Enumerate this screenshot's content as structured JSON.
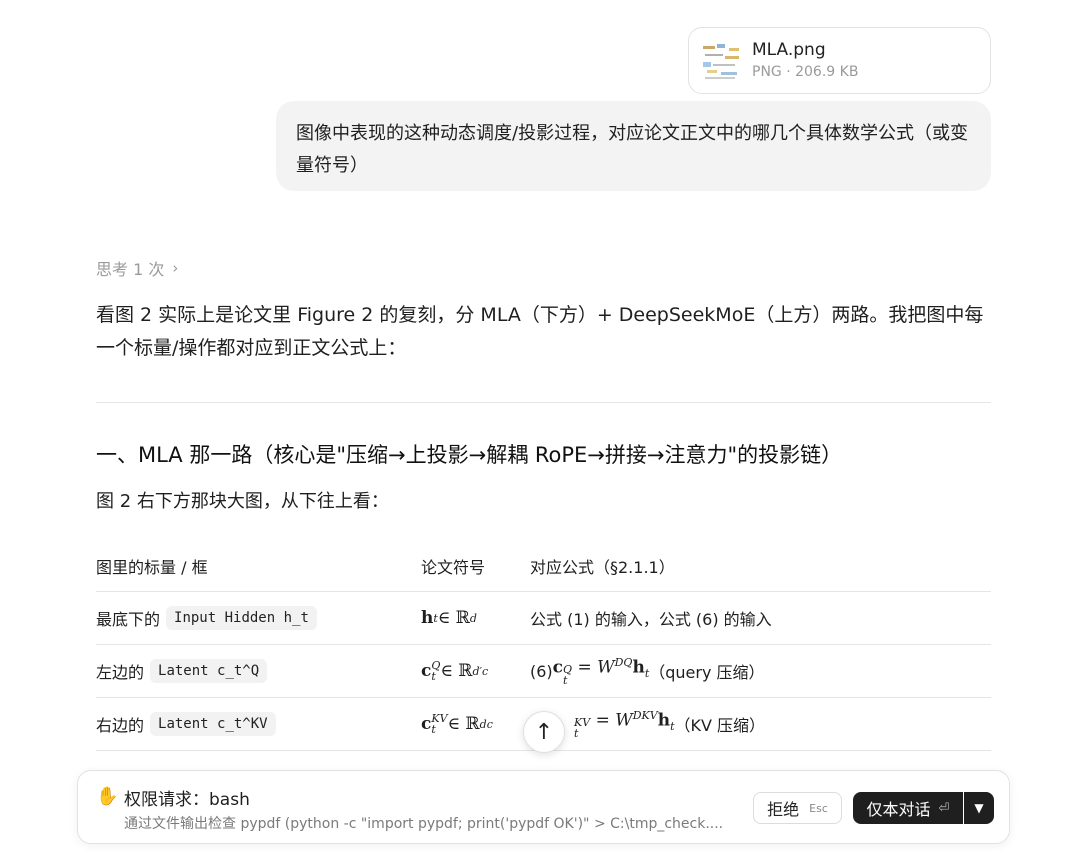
{
  "attachment": {
    "file_name": "MLA.png",
    "file_meta": "PNG · 206.9 KB"
  },
  "user_message": "图像中表现的这种动态调度/投影过程，对应论文正文中的哪几个具体数学公式（或变量符号）",
  "thinking_label": "思考 1 次",
  "intro": "看图 2 实际上是论文里 Figure 2 的复刻，分 MLA（下方）+ DeepSeekMoE（上方）两路。我把图中每一个标量/操作都对应到正文公式上：",
  "section_title": "一、MLA 那一路（核心是\"压缩→上投影→解耦 RoPE→拼接→注意力\"的投影链）",
  "section_sub": "图 2 右下方那块大图，从下往上看：",
  "table": {
    "headers": [
      "图里的标量 / 框",
      "论文符号",
      "对应公式（§2.1.1）"
    ],
    "rows": [
      {
        "prefix": "最底下的",
        "code": "Input Hidden h_t",
        "symbol": "h",
        "symbol_sub": "t",
        "symbol_rel": " ∈ ℝ",
        "symbol_sup": "d",
        "formula": "公式 (1) 的输入，公式 (6) 的输入"
      },
      {
        "prefix": "左边的",
        "code": "Latent c_t^Q",
        "symbol": "c",
        "symbol_sub": "t",
        "symbol_sup_q": "Q",
        "symbol_rel": " ∈ ℝ",
        "symbol_sup": "d′c",
        "formula_num": "(6) ",
        "formula_lhs": "c",
        "formula_lhs_sup": "Q",
        "formula_lhs_sub": "t",
        "formula_eq": " = W",
        "formula_w_sup": "DQ",
        "formula_h": "h",
        "formula_h_sub": "t",
        "formula_note": "（query 压缩）"
      },
      {
        "prefix": "右边的",
        "code": "Latent c_t^KV",
        "symbol": "c",
        "symbol_sub": "t",
        "symbol_sup_q": "KV",
        "symbol_rel": " ∈ ℝ",
        "symbol_sup": "dc",
        "formula_lhs_sup": "KV",
        "formula_lhs_sub": "t",
        "formula_eq": " = W",
        "formula_w_sup": "DKV",
        "formula_h": "h",
        "formula_h_sub": "t",
        "formula_note": "（KV 压缩）"
      }
    ]
  },
  "permission": {
    "title": "权限请求：bash",
    "description": "通过文件输出检查 pypdf (python -c \"import pypdf; print('pypdf OK')\" > C:\\tmp_check....",
    "reject_label": "拒绝",
    "reject_key": "Esc",
    "chat_only_label": "仅本对话",
    "chat_only_key": "⏎"
  }
}
